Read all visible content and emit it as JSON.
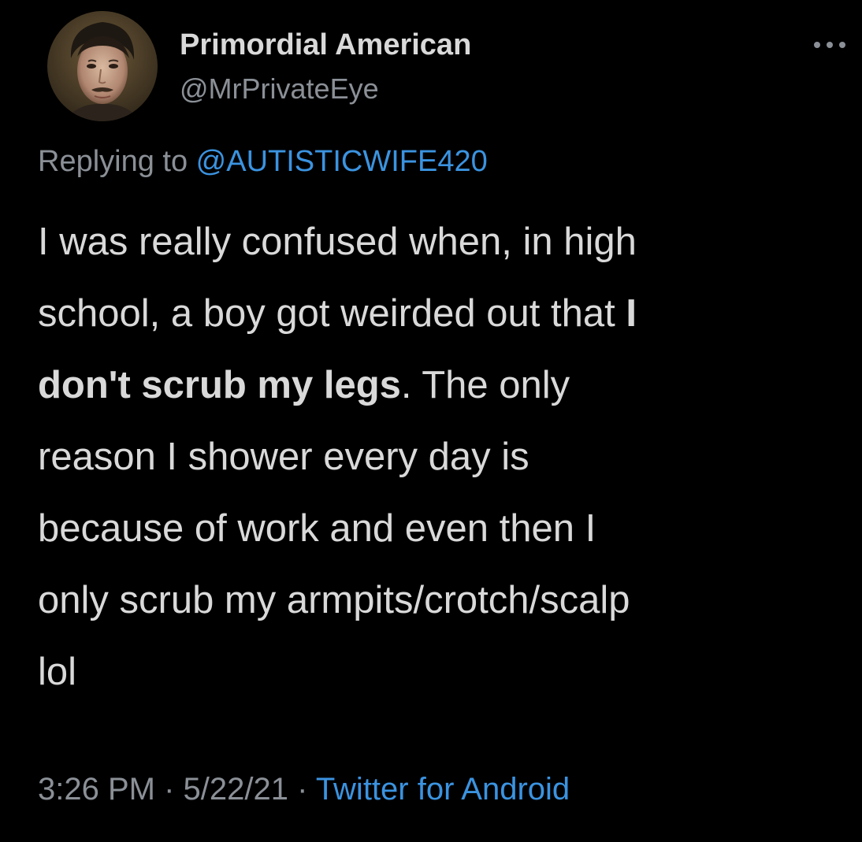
{
  "author": {
    "display_name": "Primordial American",
    "handle": "@MrPrivateEye",
    "avatar_icon": "profile-portrait"
  },
  "more_icon": "more-horizontal-icon",
  "reply": {
    "prefix": "Replying to ",
    "mention": "@AUTISTICWIFE420"
  },
  "body": {
    "line1": "I was really confused when, in high",
    "line2_start": "school, a boy got weirded out that ",
    "line2_bold": "I",
    "line3_bold": "don't scrub my legs",
    "line3_end": ". The only",
    "line4": "reason I shower every day is",
    "line5": "because of work and even then I",
    "line6": "only scrub my armpits/crotch/scalp",
    "line7": "lol"
  },
  "meta": {
    "time": "3:26 PM",
    "separator": " · ",
    "date": "5/22/21",
    "source": "Twitter for Android"
  },
  "colors": {
    "background": "#000000",
    "text": "#d9d9d9",
    "muted": "#8b9097",
    "link": "#3b93e0"
  }
}
